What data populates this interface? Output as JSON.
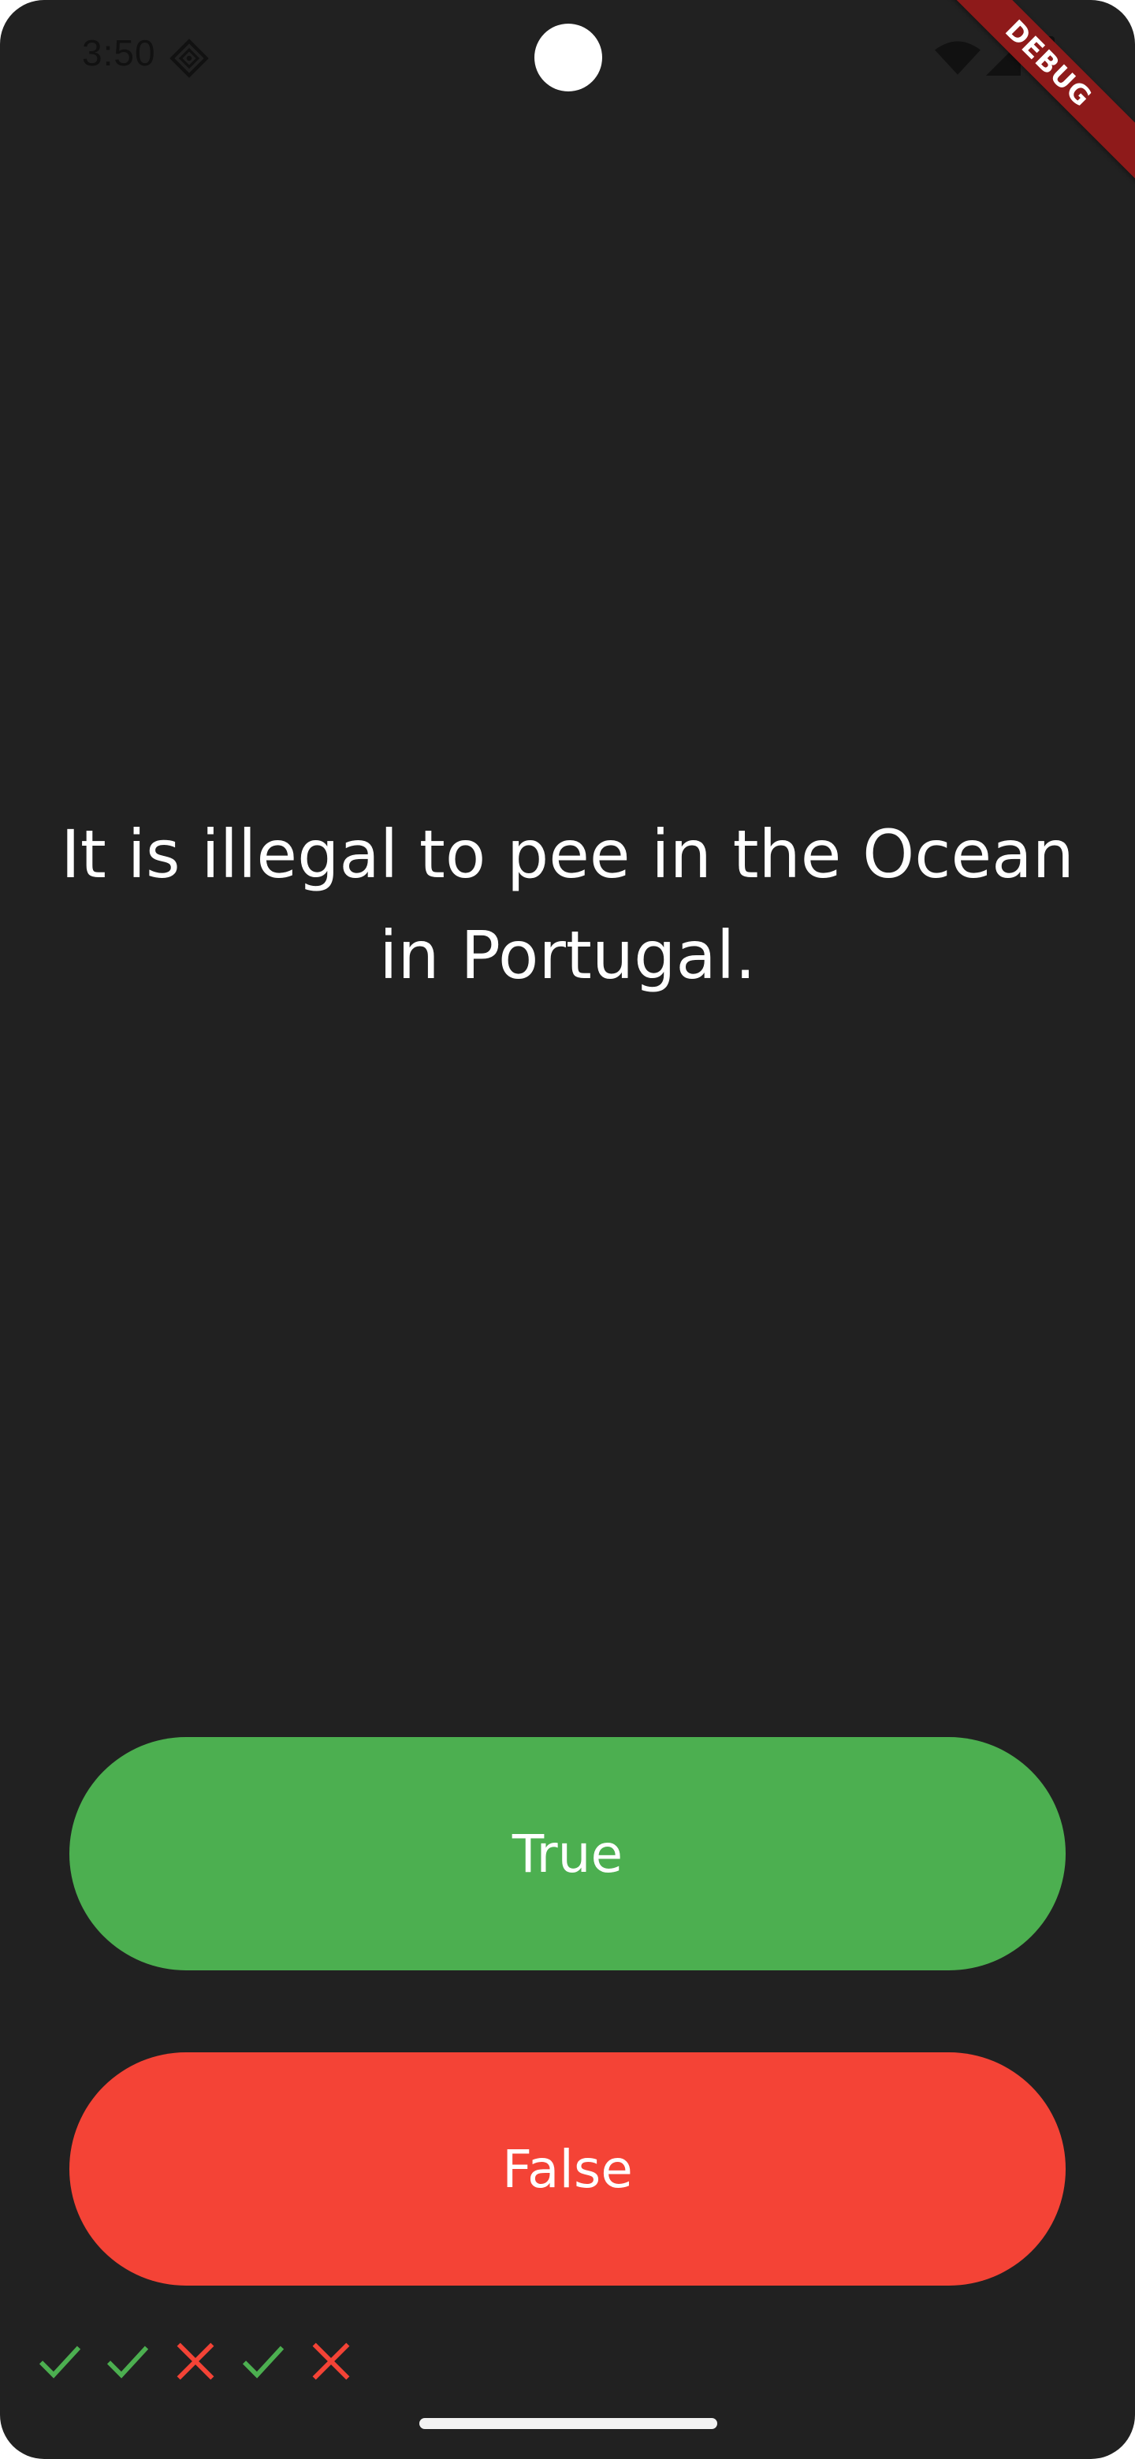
{
  "status_bar": {
    "time": "3:50",
    "icons": [
      "notification-icon",
      "wifi-icon",
      "signal-icon",
      "battery-icon"
    ]
  },
  "debug_banner": {
    "label": "DEBUG",
    "color": "#8e1a1a"
  },
  "quiz": {
    "question": "It is illegal to pee in the Ocean in Portugal.",
    "true_label": "True",
    "false_label": "False"
  },
  "colors": {
    "background": "#212121",
    "true_button": "#4caf50",
    "false_button": "#f44336",
    "correct_mark": "#4caf50",
    "wrong_mark": "#f44336"
  },
  "score_keeper": [
    "check",
    "check",
    "close",
    "check",
    "close"
  ]
}
